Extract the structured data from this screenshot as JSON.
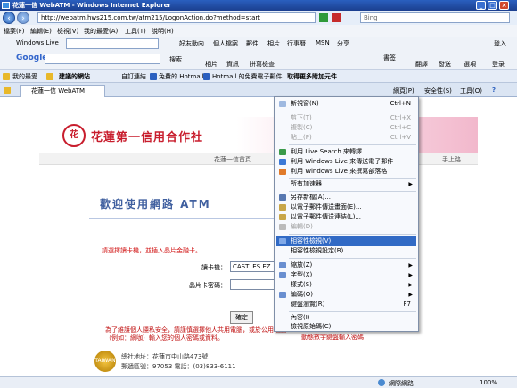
{
  "window": {
    "title": "花蓮一信 WebATM - Windows Internet Explorer"
  },
  "address": {
    "url": "http://webatm.hws215.com.tw/atm215/LogonAction.do?method=start",
    "search_placeholder": "Bing"
  },
  "menubar": {
    "items": [
      "檔案(F)",
      "編輯(E)",
      "檢視(V)",
      "我的最愛(A)",
      "工具(T)",
      "說明(H)"
    ]
  },
  "windows_live": {
    "label": "Windows Live",
    "links": [
      "好友動向",
      "個人檔案",
      "郵件",
      "相片",
      "行事曆",
      "MSN",
      "分享"
    ],
    "signin": "登入"
  },
  "google_bar": {
    "label": "Google",
    "search_btn": "搜索",
    "items": [
      "相片",
      "資訊",
      "拼寫檢查",
      "書签",
      "翻譯",
      "發送",
      "選項",
      "登录"
    ]
  },
  "favorites": {
    "label": "我的最愛",
    "items": [
      "建議的網站",
      "自訂連結",
      "免費的 Hotmail",
      "Hotmail 的免費電子郵件",
      "取得更多附加元件"
    ]
  },
  "tab": {
    "title": "花蓮一信 WebATM"
  },
  "command_bar": {
    "page": "網頁(P)",
    "safety": "安全性(S)",
    "tools": "工具(O)",
    "help": "?"
  },
  "page": {
    "bank_name": "花蓮第一信用合作社",
    "logo_char": "花",
    "nav_left": "花蓮一信首頁",
    "nav_right": "手上路",
    "welcome": "歡迎使用網路 ATM",
    "notice": "請選擇讀卡機，並插入晶片金融卡。",
    "reader_label": "讀卡機：",
    "reader_value": "CASTLES EZ",
    "pin_label": "晶片卡密碼：",
    "pin_value": "",
    "confirm": "確定",
    "warning": "為了維護個人隱私安全，請謹慎選擇他人共用電腦，或於公用電腦（例如：網咖）輸入您的個人密碼或資料。",
    "warning_right": "動態數字鍵盤輸入密碼",
    "address_line": "總社地址：花蓮市中山路473號",
    "contact_line": "郵遞區號：97053 電話：(03)833-6111",
    "seal_text": "TAIWAN"
  },
  "context_menu": {
    "items": [
      {
        "label": "新視窗(N)",
        "shortcut": "Ctrl+N",
        "disabled": false
      },
      {
        "label": "剪下(T)",
        "shortcut": "Ctrl+X",
        "disabled": true
      },
      {
        "label": "複製(C)",
        "shortcut": "Ctrl+C",
        "disabled": true
      },
      {
        "label": "貼上(P)",
        "shortcut": "Ctrl+V",
        "disabled": true
      },
      {
        "label": "利用 Live Search 來轉譯",
        "shortcut": "",
        "disabled": false
      },
      {
        "label": "利用 Windows Live 來傳送電子郵件",
        "shortcut": "",
        "disabled": false
      },
      {
        "label": "利用 Windows Live 來撰寫部落格",
        "shortcut": "",
        "disabled": false
      },
      {
        "label": "所有加速器",
        "shortcut": "",
        "disabled": false,
        "submenu": true
      },
      {
        "label": "另存新檔(A)...",
        "shortcut": "",
        "disabled": false
      },
      {
        "label": "以電子郵件傳送畫面(E)...",
        "shortcut": "",
        "disabled": false
      },
      {
        "label": "以電子郵件傳送連結(L)...",
        "shortcut": "",
        "disabled": false
      },
      {
        "label": "編輯(D)",
        "shortcut": "",
        "disabled": true
      },
      {
        "label": "相容性檢視(V)",
        "shortcut": "",
        "disabled": false,
        "selected": true
      },
      {
        "label": "相容性檢視設定(B)",
        "shortcut": "",
        "disabled": false
      },
      {
        "label": "縮放(Z)",
        "shortcut": "",
        "disabled": false,
        "submenu": true
      },
      {
        "label": "字型(X)",
        "shortcut": "",
        "disabled": false,
        "submenu": true
      },
      {
        "label": "樣式(S)",
        "shortcut": "",
        "disabled": false,
        "submenu": true
      },
      {
        "label": "編碼(O)",
        "shortcut": "",
        "disabled": false,
        "submenu": true
      },
      {
        "label": "鍵盤瀏覽(R)",
        "shortcut": "F7",
        "disabled": false
      },
      {
        "label": "內容(I)",
        "shortcut": "",
        "disabled": false
      },
      {
        "label": "檢視原始碼(C)",
        "shortcut": "",
        "disabled": false
      }
    ]
  },
  "status": {
    "zone": "網際網路",
    "zoom": "100%"
  }
}
